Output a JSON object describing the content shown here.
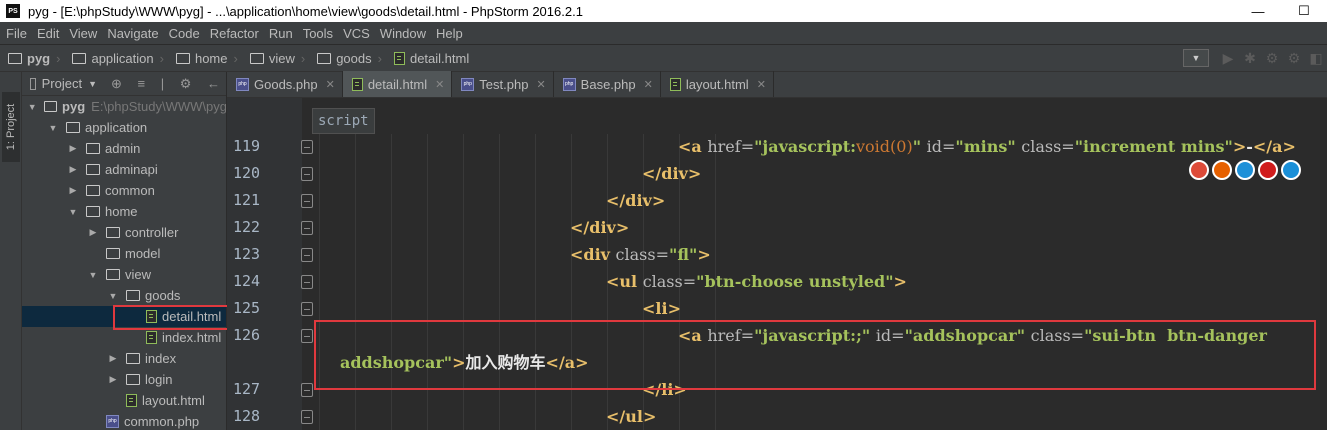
{
  "window": {
    "logo_text": "PS",
    "title": "pyg - [E:\\phpStudy\\WWW\\pyg] - ...\\application\\home\\view\\goods\\detail.html - PhpStorm 2016.2.1",
    "minimize": "—",
    "maximize": "☐"
  },
  "menu": [
    "File",
    "Edit",
    "View",
    "Navigate",
    "Code",
    "Refactor",
    "Run",
    "Tools",
    "VCS",
    "Window",
    "Help"
  ],
  "breadcrumbs": [
    "pyg",
    "application",
    "home",
    "view",
    "goods",
    "detail.html"
  ],
  "project_panel": {
    "tab_label": "1: Project",
    "header": "Project",
    "tools": "⊕ ≡ | ⚙ ←",
    "tree": [
      {
        "label": "pyg",
        "path": "E:\\phpStudy\\WWW\\pyg",
        "type": "folder",
        "state": "open",
        "depth": 0
      },
      {
        "label": "application",
        "type": "folder",
        "state": "open",
        "depth": 1
      },
      {
        "label": "admin",
        "type": "folder",
        "state": "closed",
        "depth": 2
      },
      {
        "label": "adminapi",
        "type": "folder",
        "state": "closed",
        "depth": 2
      },
      {
        "label": "common",
        "type": "folder",
        "state": "closed",
        "depth": 2
      },
      {
        "label": "home",
        "type": "folder",
        "state": "open",
        "depth": 2
      },
      {
        "label": "controller",
        "type": "folder",
        "state": "closed",
        "depth": 3
      },
      {
        "label": "model",
        "type": "folder",
        "state": "none",
        "depth": 3
      },
      {
        "label": "view",
        "type": "folder",
        "state": "open",
        "depth": 3
      },
      {
        "label": "goods",
        "type": "folder",
        "state": "open",
        "depth": 4
      },
      {
        "label": "detail.html",
        "type": "html",
        "state": "none",
        "depth": 5,
        "selected": true
      },
      {
        "label": "index.html",
        "type": "html",
        "state": "none",
        "depth": 5
      },
      {
        "label": "index",
        "type": "folder",
        "state": "closed",
        "depth": 4
      },
      {
        "label": "login",
        "type": "folder",
        "state": "closed",
        "depth": 4
      },
      {
        "label": "layout.html",
        "type": "html",
        "state": "none",
        "depth": 4
      },
      {
        "label": "common.php",
        "type": "php",
        "state": "none",
        "depth": 3
      }
    ]
  },
  "editor_tabs": [
    {
      "label": "Goods.php",
      "type": "php",
      "active": false
    },
    {
      "label": "detail.html",
      "type": "html",
      "active": true
    },
    {
      "label": "Test.php",
      "type": "php",
      "active": false
    },
    {
      "label": "Base.php",
      "type": "php",
      "active": false
    },
    {
      "label": "layout.html",
      "type": "html",
      "active": false
    }
  ],
  "editor": {
    "context_tag": "script",
    "line_numbers": [
      "119",
      "120",
      "121",
      "122",
      "123",
      "124",
      "125",
      "126",
      "",
      "127",
      "128"
    ],
    "lines": [
      {
        "indent": 10,
        "tokens": [
          [
            "t",
            "<a "
          ],
          [
            "a",
            "href="
          ],
          [
            "v",
            "\"javascript:"
          ],
          [
            "k",
            "void(0)"
          ],
          [
            "v",
            "\" "
          ],
          [
            "a",
            "id="
          ],
          [
            "v",
            "\"mins\" "
          ],
          [
            "a",
            "class="
          ],
          [
            "v",
            "\"increment mins\""
          ],
          [
            "t",
            ">"
          ],
          [
            "x",
            "-"
          ],
          [
            "t",
            "</a>"
          ]
        ]
      },
      {
        "indent": 9,
        "tokens": [
          [
            "t",
            "</div>"
          ]
        ]
      },
      {
        "indent": 8,
        "tokens": [
          [
            "t",
            "</div>"
          ]
        ]
      },
      {
        "indent": 7,
        "tokens": [
          [
            "t",
            "</div>"
          ]
        ]
      },
      {
        "indent": 7,
        "tokens": [
          [
            "t",
            "<div "
          ],
          [
            "a",
            "class="
          ],
          [
            "v",
            "\"fl\""
          ],
          [
            "t",
            ">"
          ]
        ]
      },
      {
        "indent": 8,
        "tokens": [
          [
            "t",
            "<ul "
          ],
          [
            "a",
            "class="
          ],
          [
            "v",
            "\"btn-choose unstyled\""
          ],
          [
            "t",
            ">"
          ]
        ]
      },
      {
        "indent": 9,
        "tokens": [
          [
            "t",
            "<li>"
          ]
        ]
      },
      {
        "indent": 10,
        "tokens": [
          [
            "t",
            "<a "
          ],
          [
            "a",
            "href="
          ],
          [
            "v",
            "\"javascript:;\" "
          ],
          [
            "a",
            "id="
          ],
          [
            "v",
            "\"addshopcar\" "
          ],
          [
            "a",
            "class="
          ],
          [
            "v",
            "\"sui-btn  btn-danger"
          ]
        ]
      },
      {
        "indent": 0,
        "tokens": [
          [
            "v",
            "addshopcar\""
          ],
          [
            "t",
            ">"
          ],
          [
            "x",
            "加入购物车"
          ],
          [
            "t",
            "</a>"
          ]
        ]
      },
      {
        "indent": 9,
        "tokens": [
          [
            "t",
            "</li>"
          ]
        ]
      },
      {
        "indent": 8,
        "tokens": [
          [
            "t",
            "</ul>"
          ]
        ]
      }
    ]
  },
  "browser_icons": [
    "chrome-icon",
    "firefox-icon",
    "safari-icon",
    "opera-icon",
    "ie-icon"
  ],
  "colors": {
    "tag": "#e8bf6a",
    "attr": "#bababa",
    "value": "#a5c25c",
    "keyword": "#cc7832",
    "highlight_box": "#e0393e"
  }
}
